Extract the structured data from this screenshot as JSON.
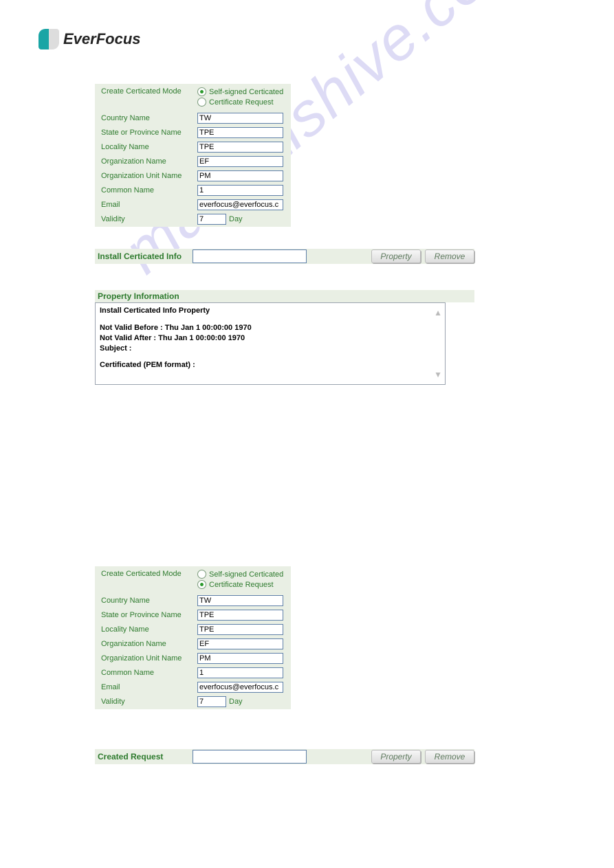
{
  "brand": "EverFocus",
  "watermark": "manualshive.com",
  "labels": {
    "mode": "Create Certicated Mode",
    "opt_self": "Self-signed Certicated",
    "opt_req": "Certificate Request",
    "country": "Country Name",
    "state": "State or Province Name",
    "locality": "Locality Name",
    "org": "Organization Name",
    "orgunit": "Organization Unit Name",
    "common": "Common Name",
    "email": "Email",
    "validity": "Validity",
    "day": "Day"
  },
  "form1": {
    "selected": "self",
    "country": "TW",
    "state": "TPE",
    "locality": "TPE",
    "org": "EF",
    "orgunit": "PM",
    "common": "1",
    "email": "everfocus@everfocus.c",
    "validity": "7"
  },
  "install_bar": {
    "title": "Install Certicated Info",
    "value": "",
    "btn_property": "Property",
    "btn_remove": "Remove"
  },
  "property_info": {
    "header": "Property Information",
    "line1": "Install Certicated Info Property",
    "line2": "Not Valid Before :  Thu Jan  1 00:00:00 1970",
    "line3": "Not Valid After :  Thu Jan  1 00:00:00 1970",
    "line4": "Subject :",
    "line5": "Certificated (PEM format) :"
  },
  "form2": {
    "selected": "req",
    "country": "TW",
    "state": "TPE",
    "locality": "TPE",
    "org": "EF",
    "orgunit": "PM",
    "common": "1",
    "email": "everfocus@everfocus.c",
    "validity": "7"
  },
  "created_bar": {
    "title": "Created Request",
    "value": "",
    "btn_property": "Property",
    "btn_remove": "Remove"
  }
}
